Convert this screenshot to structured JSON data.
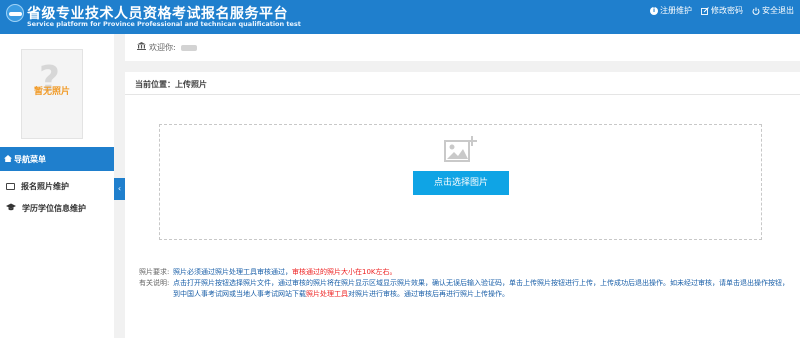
{
  "header": {
    "title": "省级专业技术人员资格考试报名服务平台",
    "subtitle": "Service platform for Province Professional and technican qualification test",
    "links": [
      {
        "label": "注册维护",
        "icon": "info-icon"
      },
      {
        "label": "修改密码",
        "icon": "edit-icon"
      },
      {
        "label": "安全退出",
        "icon": "power-icon"
      }
    ]
  },
  "sidebar": {
    "photo_placeholder": "暂无照片",
    "nav_title": "导航菜单",
    "items": [
      {
        "label": "报名照片维护",
        "icon": "image-icon"
      },
      {
        "label": "学历学位信息维护",
        "icon": "graduation-cap-icon"
      }
    ]
  },
  "welcome": {
    "label": "欢迎你:"
  },
  "main": {
    "breadcrumb": "当前位置：上传照片",
    "upload_button": "点击选择图片",
    "notes": {
      "req_label": "照片要求:",
      "req_text": "照片必须通过照片处理工具审核通过，",
      "req_highlight": "审核通过的照片大小在10K左右。",
      "desc_label": "有关说明:",
      "desc_text1": "点击打开照片按钮选择照片文件，通过审核的照片将在照片显示区域显示照片效果，确认无误后输入验证码，单击上传照片按钮进行上传，上传成功后退出操作。如未经过审核，请单击退出操作按钮，到中国人事考试网或当地人事考试网站下载",
      "desc_highlight": "照片处理工具",
      "desc_text2": "对照片进行审核。通过审核后再进行照片上传操作。"
    }
  },
  "colors": {
    "brand": "#1f7fcd",
    "button": "#0fa4e5",
    "highlight": "#e22222",
    "note_text": "#1a5fa8"
  }
}
